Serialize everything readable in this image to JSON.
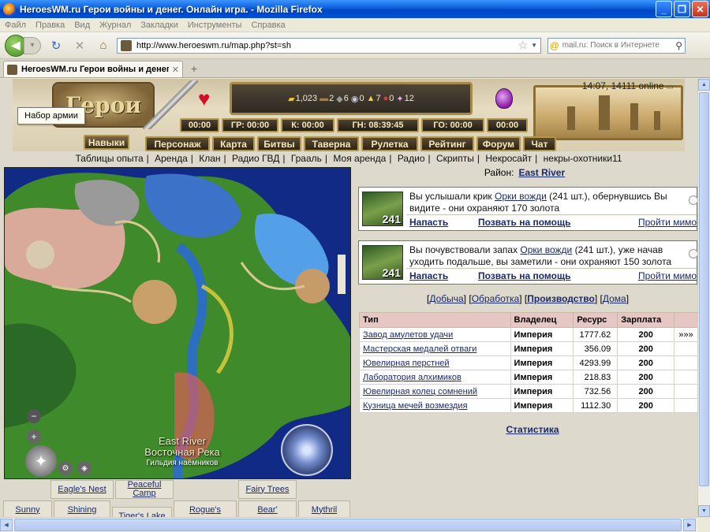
{
  "window": {
    "title": "HeroesWM.ru Герои войны и денег. Онлайн игра. - Mozilla Firefox",
    "min": "_",
    "max": "❐",
    "close": "✕"
  },
  "menu": [
    "Файл",
    "Правка",
    "Вид",
    "Журнал",
    "Закладки",
    "Инструменты",
    "Справка"
  ],
  "toolbar": {
    "url": "http://www.heroeswm.ru/map.php?st=sh",
    "search_placeholder": "mail.ru: Поиск в Интернете",
    "back": "◀",
    "forward": "▾",
    "reload": "↻",
    "stop": "✕",
    "home": "⌂",
    "search_engine": "@"
  },
  "tabs": [
    {
      "label": "HeroesWM.ru Герои войны и денег. ..."
    }
  ],
  "game": {
    "logo": "Герои",
    "tooltip": "Набор армии",
    "clock": "14:07, 14111 online",
    "resources": {
      "gold": "1,023",
      "wood": "2",
      "ore": "6",
      "mercury": "0",
      "sulfur": "7",
      "crystals": "0",
      "gems": "12"
    },
    "timers": [
      "00:00",
      "ГР: 00:00",
      "К: 00:00",
      "ГН: 08:39:45",
      "ГО: 00:00",
      "00:00"
    ],
    "nav": {
      "skills": "Навыки",
      "character": "Персонаж",
      "map": "Карта",
      "battles": "Битвы",
      "tavern": "Таверна",
      "roulette": "Рулетка",
      "rating": "Рейтинг",
      "forum": "Форум",
      "chat": "Чат"
    },
    "sublinks": [
      "Таблицы опыта",
      "Аренда",
      "Клан",
      "Радио ГВД",
      "Грааль",
      "Моя аренда",
      "Радио",
      "Скрипты",
      "Некросайт",
      "некры-охотники11"
    ]
  },
  "map": {
    "region_label": "Район:",
    "region_name": "East River",
    "caption_en": "East River",
    "caption_ru": "Восточная Река",
    "caption_guild": "Гильдия наёмников",
    "zoom_out": "−",
    "zoom_in": "+",
    "sectors": [
      "Eagle's Nest",
      "Peaceful Camp",
      "Fairy Trees",
      "Sunny",
      "Shining",
      "Tiger's Lake",
      "Rogue's",
      "Bear'",
      "Mythril"
    ]
  },
  "events": [
    {
      "count": "241",
      "text_before": "Вы услышали крик ",
      "monster": "Орки вожди",
      "text_after": " (241 шт.), обернувшись Вы видите - они охраняют 170 золота",
      "attack": "Напасть",
      "help": "Позвать на помощь",
      "pass": "Пройти мимо"
    },
    {
      "count": "241",
      "text_before": "Вы почувствовали запах ",
      "monster": "Орки вожди",
      "text_after": " (241 шт.), уже начав уходить подальше, вы заметили - они охраняют 150 золота",
      "attack": "Напасть",
      "help": "Позвать на помощь",
      "pass": "Пройти мимо"
    }
  ],
  "subtabs": {
    "mining": "Добыча",
    "processing": "Обработка",
    "production": "Производство",
    "houses": "Дома"
  },
  "table": {
    "headers": [
      "Тип",
      "Владелец",
      "Ресурс",
      "Зарплата"
    ],
    "more": "»»»",
    "rows": [
      [
        "Завод амулетов удачи",
        "Империя",
        "1777.62",
        "200"
      ],
      [
        "Мастерская медалей отваги",
        "Империя",
        "356.09",
        "200"
      ],
      [
        "Ювелирная перстней",
        "Империя",
        "4293.99",
        "200"
      ],
      [
        "Лаборатория алхимиков",
        "Империя",
        "218.83",
        "200"
      ],
      [
        "Ювелирная колец сомнений",
        "Империя",
        "732.56",
        "200"
      ],
      [
        "Кузница мечей возмездия",
        "Империя",
        "1112.30",
        "200"
      ]
    ]
  },
  "statistics": "Статистика"
}
